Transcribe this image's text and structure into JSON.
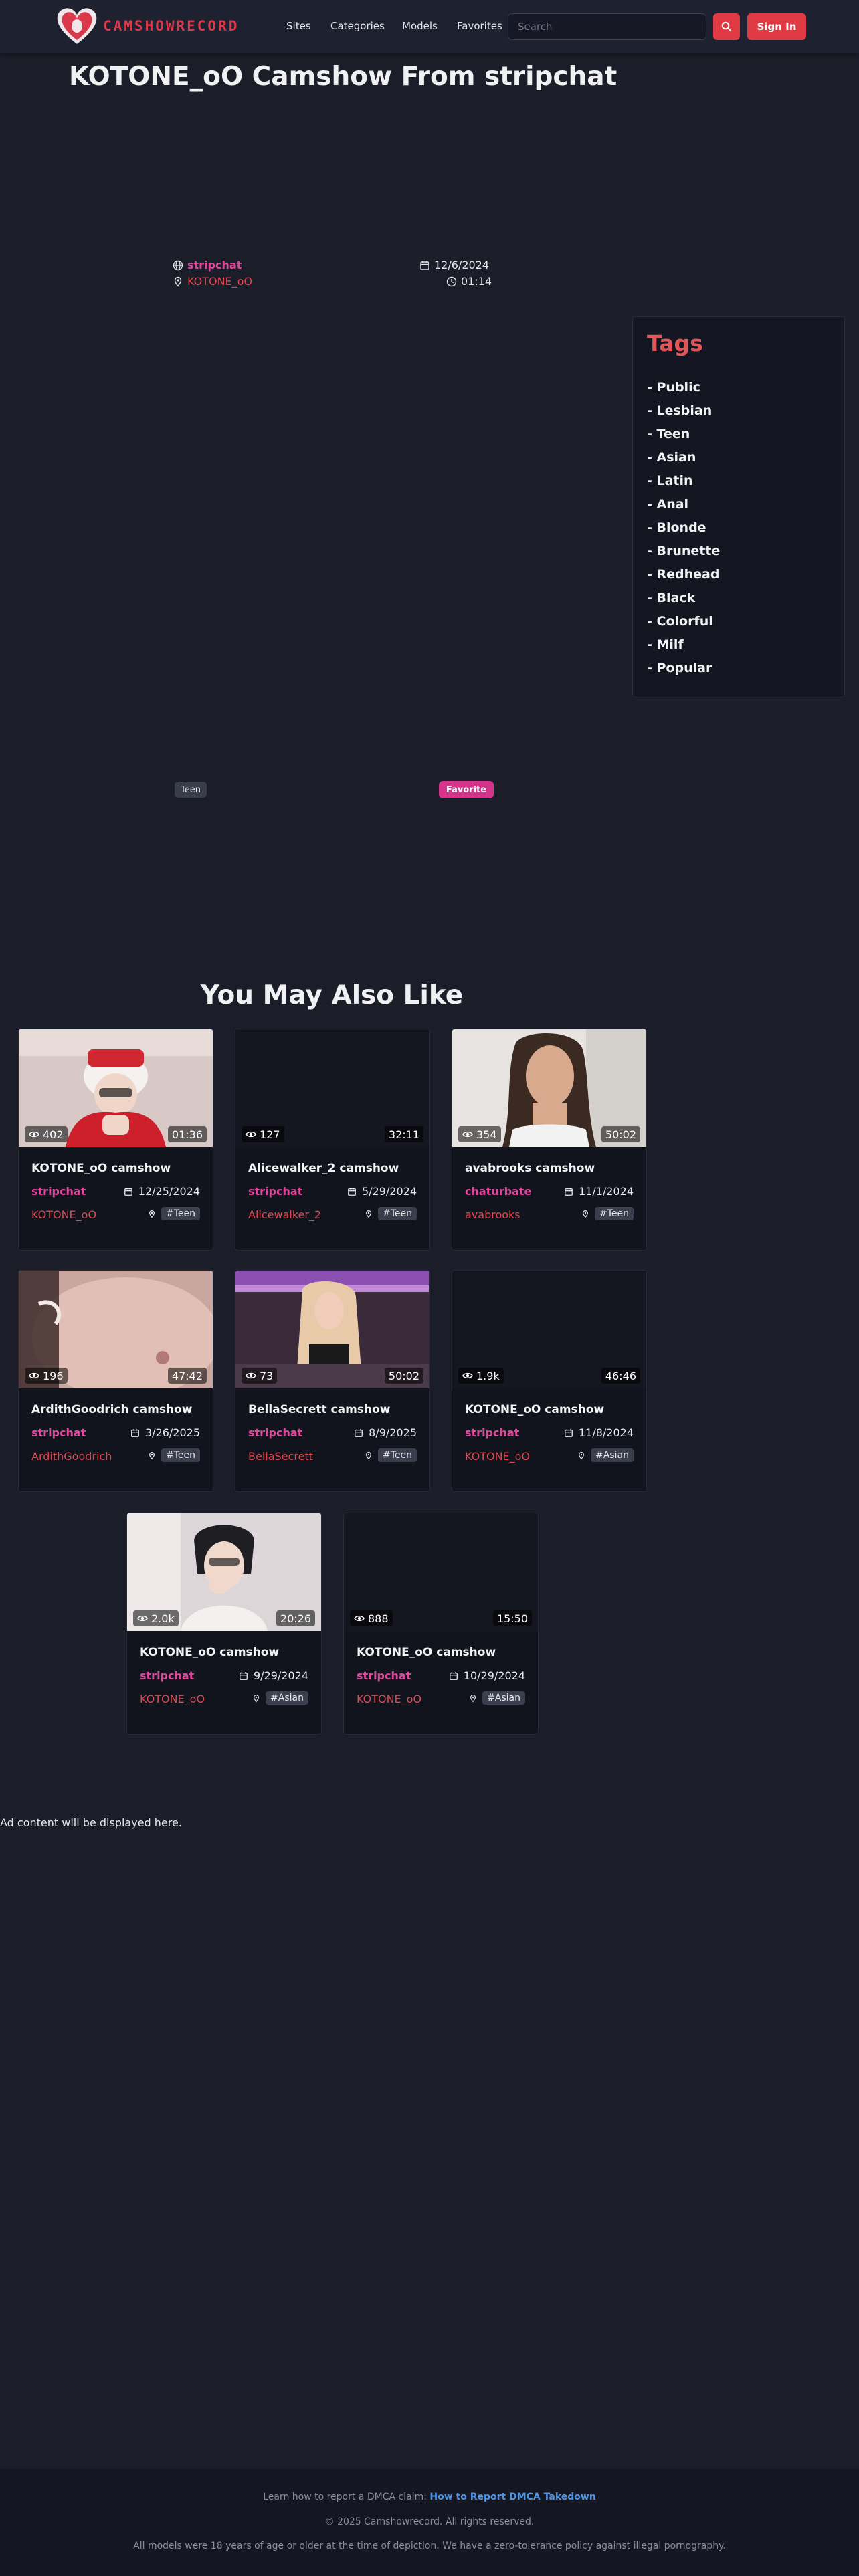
{
  "header": {
    "logo_text": "CAMSHOWRECORD",
    "nav": [
      "Sites",
      "Categories",
      "Models",
      "Favorites"
    ],
    "search_placeholder": "Search",
    "signin_label": "Sign In"
  },
  "video": {
    "title": "KOTONE_oO Camshow From stripchat",
    "site": "stripchat",
    "model": "KOTONE_oO",
    "date": "12/6/2024",
    "duration": "01:14",
    "tag_chip": "Teen",
    "favorite_label": "Favorite"
  },
  "tags": {
    "title": "Tags",
    "items": [
      "- Public",
      "- Lesbian",
      "- Teen",
      "- Asian",
      "- Latin",
      "- Anal",
      "- Blonde",
      "- Brunette",
      "- Redhead",
      "- Black",
      "- Colorful",
      "- Milf",
      "- Popular"
    ]
  },
  "related": {
    "title": "You May Also Like",
    "cards": [
      {
        "title": "KOTONE_oO camshow",
        "site": "stripchat",
        "date": "12/25/2024",
        "model": "KOTONE_oO",
        "tag": "#Teen",
        "views": "402",
        "duration": "01:36"
      },
      {
        "title": "Alicewalker_2 camshow",
        "site": "stripchat",
        "date": "5/29/2024",
        "model": "Alicewalker_2",
        "tag": "#Teen",
        "views": "127",
        "duration": "32:11"
      },
      {
        "title": "avabrooks camshow",
        "site": "chaturbate",
        "date": "11/1/2024",
        "model": "avabrooks",
        "tag": "#Teen",
        "views": "354",
        "duration": "50:02"
      },
      {
        "title": "ArdithGoodrich camshow",
        "site": "stripchat",
        "date": "3/26/2025",
        "model": "ArdithGoodrich",
        "tag": "#Teen",
        "views": "196",
        "duration": "47:42"
      },
      {
        "title": "BellaSecrett camshow",
        "site": "stripchat",
        "date": "8/9/2025",
        "model": "BellaSecrett",
        "tag": "#Teen",
        "views": "73",
        "duration": "50:02"
      },
      {
        "title": "KOTONE_oO camshow",
        "site": "stripchat",
        "date": "11/8/2024",
        "model": "KOTONE_oO",
        "tag": "#Asian",
        "views": "1.9k",
        "duration": "46:46"
      },
      {
        "title": "KOTONE_oO camshow",
        "site": "stripchat",
        "date": "9/29/2024",
        "model": "KOTONE_oO",
        "tag": "#Asian",
        "views": "2.0k",
        "duration": "20:26"
      },
      {
        "title": "KOTONE_oO camshow",
        "site": "stripchat",
        "date": "10/29/2024",
        "model": "KOTONE_oO",
        "tag": "#Asian",
        "views": "888",
        "duration": "15:50"
      }
    ]
  },
  "ad_note": "Ad content will be displayed here.",
  "footer": {
    "dmca_prefix": "Learn how to report a DMCA claim: ",
    "dmca_link": "How to Report DMCA Takedown",
    "copyright": "© 2025 Camshowrecord. All rights reserved.",
    "disclaimer": "All models were 18 years of age or older at the time of depiction. We have a zero-tolerance policy against illegal pornography."
  },
  "colors": {
    "background": "#1b1e29",
    "accent_red": "#e03a44",
    "site_pink": "#e0489d",
    "model_red": "#e0474e",
    "tags_title": "#e2565a",
    "link_blue": "#4e95e6"
  }
}
